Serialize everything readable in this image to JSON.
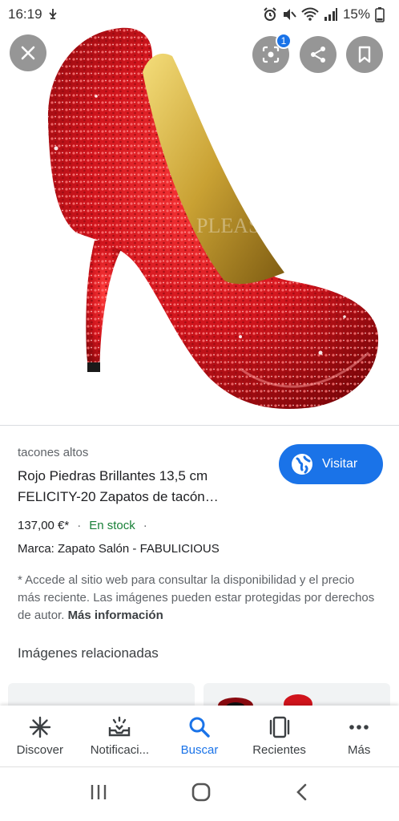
{
  "status_bar": {
    "time": "16:19",
    "battery": "15%"
  },
  "hero": {
    "lens_badge": "1",
    "watermark": "PLEASER USA"
  },
  "product": {
    "category": "tacones altos",
    "title_line1": "Rojo Piedras Brillantes 13,5 cm",
    "title_line2": "FELICITY-20 Zapatos de tacón…",
    "price": "137,00 €*",
    "separator": "·",
    "stock": "En stock",
    "brand": "Marca: Zapato Salón - FABULICIOUS",
    "visit_label": "Visitar",
    "disclaimer": "* Accede al sitio web para consultar la disponibilidad y el precio más reciente. Las imágenes pueden estar protegidas por derechos de autor.",
    "more_info": "Más información",
    "related_heading": "Imágenes relacionadas"
  },
  "bottom_nav": {
    "items": [
      {
        "label": "Discover",
        "icon": "asterisk-icon"
      },
      {
        "label": "Notificaci...",
        "icon": "notifications-tray-icon"
      },
      {
        "label": "Buscar",
        "icon": "search-icon"
      },
      {
        "label": "Recientes",
        "icon": "recents-icon"
      },
      {
        "label": "Más",
        "icon": "more-dots-icon"
      }
    ],
    "active_index": 2
  },
  "colors": {
    "accent": "#1a73e8",
    "in_stock": "#188038",
    "shoe_red": "#d0141c"
  }
}
